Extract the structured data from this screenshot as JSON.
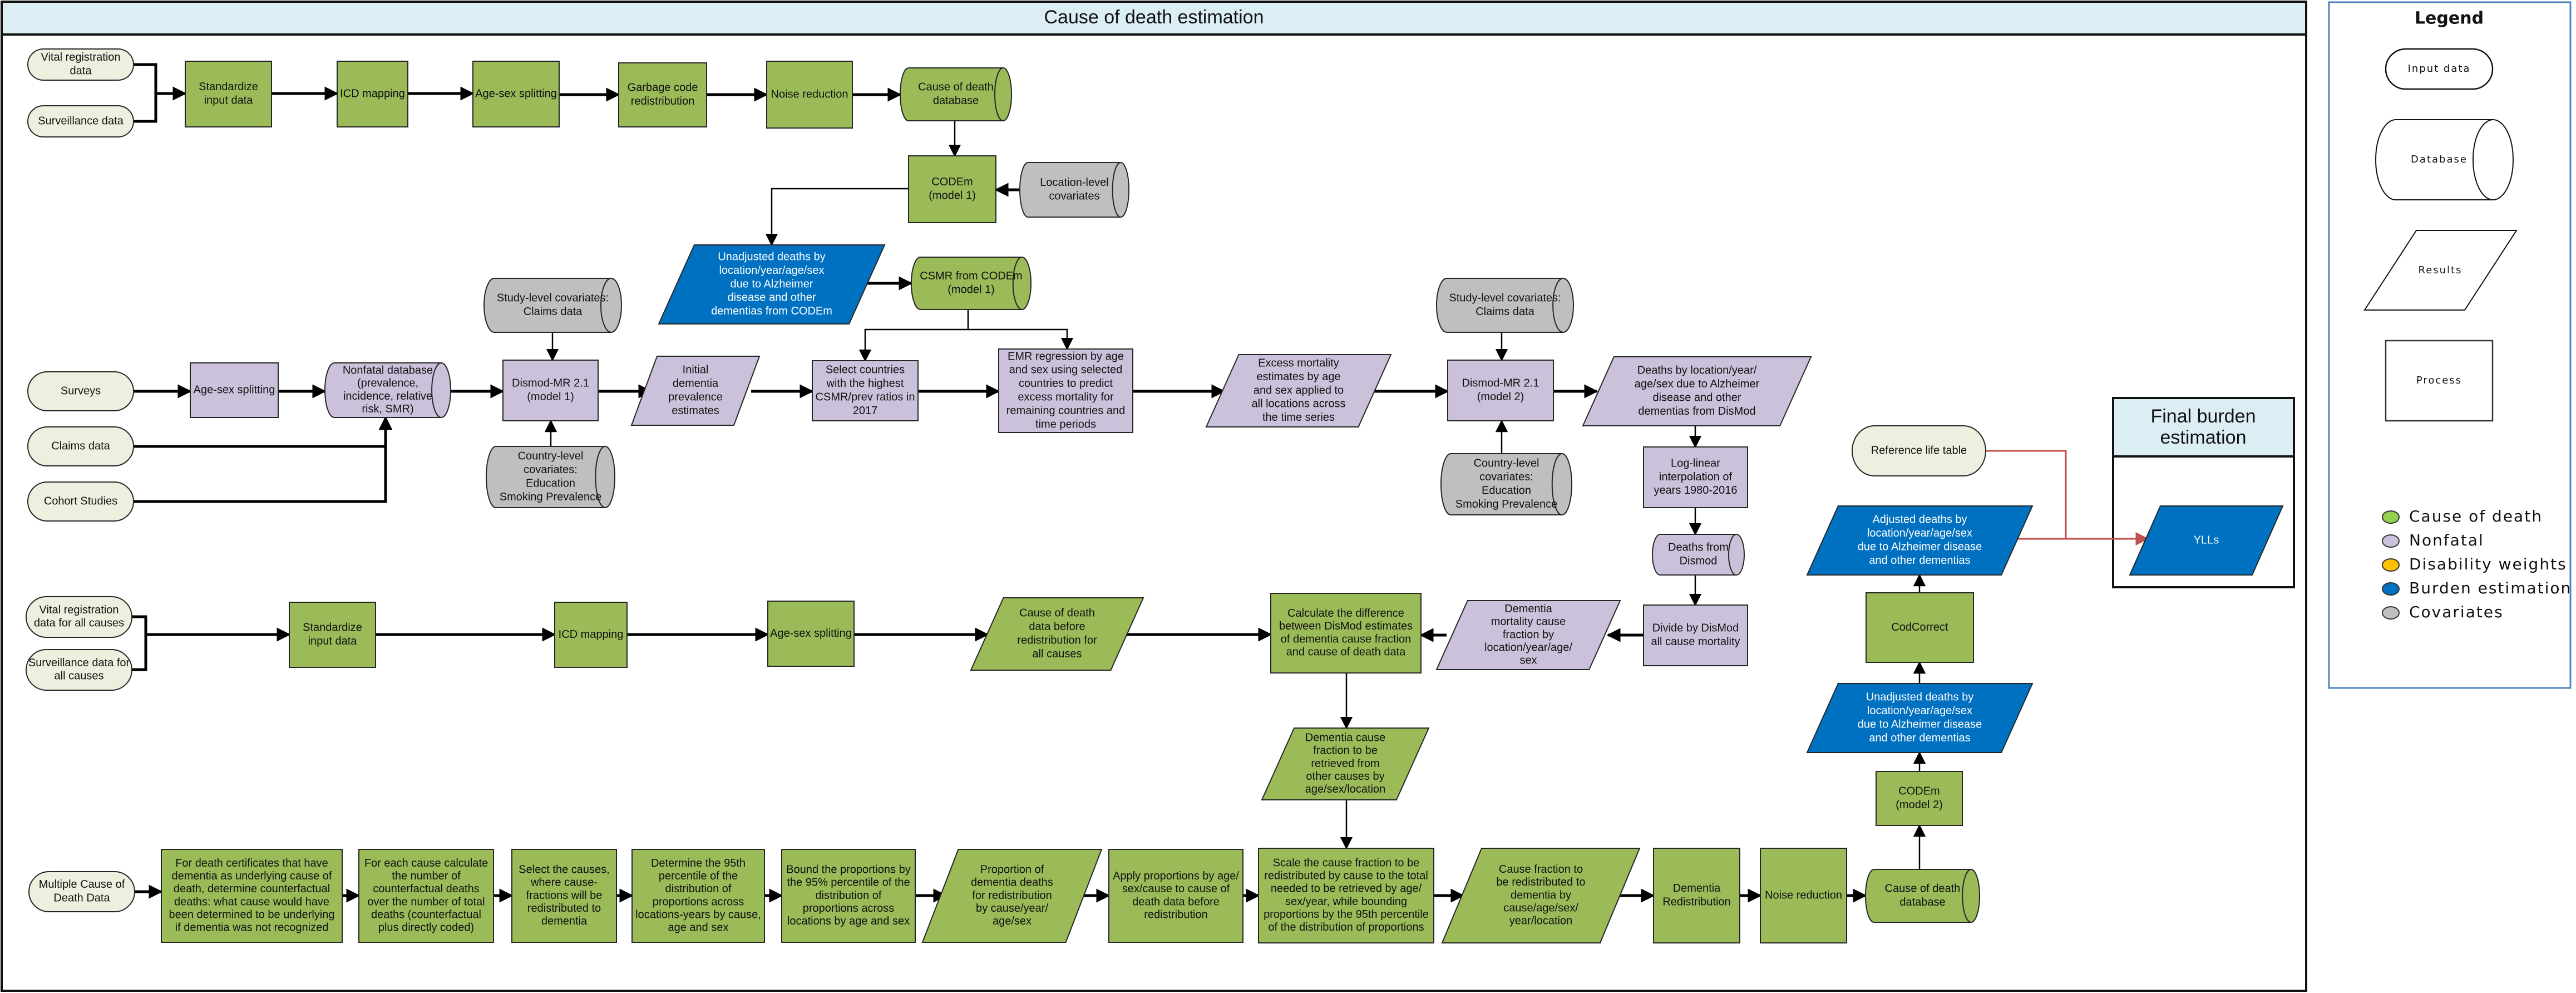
{
  "title": "Cause of death estimation",
  "colors": {
    "cause_of_death": "#9bbb59",
    "nonfatal": "#ccc1da",
    "disability_weights": "#ffc000",
    "burden_estimation": "#0070c0",
    "covariates": "#bfbfbf",
    "input": "#ebf1de",
    "header": "#dbeef4",
    "red_edge": "#c0504d"
  },
  "nodes": {
    "vr_data": [
      "Vital registration",
      "data"
    ],
    "surv_data": [
      "Surveillance data"
    ],
    "std_input_1": [
      "Standardize",
      "input data"
    ],
    "icd_map_1": [
      "ICD mapping"
    ],
    "agesex_1": [
      "Age-sex splitting"
    ],
    "garbage": [
      "Garbage code",
      "redistribution"
    ],
    "noise_1": [
      "Noise reduction"
    ],
    "cod_db_1": [
      "Cause of death",
      "database"
    ],
    "codem_1": [
      "CODEm",
      "(model 1)"
    ],
    "loc_cov": [
      "Location-level",
      "covariates"
    ],
    "unadj_codem": [
      "Unadjusted deaths by",
      "location/year/age/sex",
      "due to Alzheimer",
      "disease and other",
      "dementias from CODEm"
    ],
    "csmr": [
      "CSMR from CODEm",
      "(model 1)"
    ],
    "study_cov_1": [
      "Study-level covariates:",
      "Claims data"
    ],
    "country_cov_1": [
      "Country-level",
      "covariates:",
      "Education",
      "Smoking Prevalence"
    ],
    "surveys": [
      "Surveys"
    ],
    "claims": [
      "Claims data"
    ],
    "cohort": [
      "Cohort Studies"
    ],
    "agesex_nf": [
      "Age-sex splitting"
    ],
    "nonfatal_db": [
      "Nonfatal database",
      "(prevalence,",
      "incidence, relative",
      "risk, SMR)"
    ],
    "dismod_1": [
      "Dismod-MR 2.1",
      "(model 1)"
    ],
    "initial_prev": [
      "Initial",
      "dementia",
      "prevalence",
      "estimates"
    ],
    "select_countries": [
      "Select countries",
      "with the highest",
      "CSMR/prev ratios in",
      "2017"
    ],
    "emr_reg": [
      "EMR regression by age",
      "and sex using selected",
      "countries to predict",
      "excess mortality for",
      "remaining countries and",
      "time periods"
    ],
    "excess_mort": [
      "Excess mortality",
      "estimates by age",
      "and sex applied to",
      "all locations across",
      "the time series"
    ],
    "study_cov_2": [
      "Study-level covariates:",
      "Claims data"
    ],
    "country_cov_2": [
      "Country-level",
      "covariates:",
      "Education",
      "Smoking Prevalence"
    ],
    "dismod_2": [
      "Dismod-MR 2.1",
      "(model 2)"
    ],
    "deaths_dismod": [
      "Deaths by location/year/",
      "age/sex due to Alzheimer",
      "disease and other",
      "dementias from DisMod"
    ],
    "loglinear": [
      "Log-linear",
      "interpolation of",
      "years 1980-2016"
    ],
    "deaths_from_dismod": [
      "Deaths from",
      "Dismod"
    ],
    "divide_dismod": [
      "Divide by DisMod",
      "all cause mortality"
    ],
    "dementia_mcf": [
      "Dementia",
      "mortality cause",
      "fraction by",
      "location/year/age/",
      "sex"
    ],
    "ref_life": [
      "Reference life table"
    ],
    "adj_deaths": [
      "Adjusted deaths by",
      "location/year/age/sex",
      "due to Alzheimer disease",
      "and other dementias"
    ],
    "codcorrect": [
      "CodCorrect"
    ],
    "unadj_2": [
      "Unadjusted deaths by",
      "location/year/age/sex",
      "due to Alzheimer disease",
      "and other dementias"
    ],
    "codem_2": [
      "CODEm",
      "(model 2)"
    ],
    "vr_all": [
      "Vital registration",
      "data for all causes"
    ],
    "surv_all": [
      "Surveillance data for",
      "all causes"
    ],
    "std_input_2": [
      "Standardize",
      "input data"
    ],
    "icd_map_2": [
      "ICD mapping"
    ],
    "agesex_2": [
      "Age-sex splitting"
    ],
    "cod_before": [
      "Cause of death",
      "data before",
      "redistribution for",
      "all causes"
    ],
    "calc_diff": [
      "Calculate the difference",
      "between DisMod estimates",
      "of dementia cause fraction",
      "and cause of death data"
    ],
    "dem_cf_retrieve": [
      "Dementia cause",
      "fraction to be",
      "retrieved from",
      "other causes by",
      "age/sex/location"
    ],
    "mcod": [
      "Multiple Cause of",
      "Death Data"
    ],
    "counterfactual": [
      "For death certificates that have",
      "dementia as underlying cause of",
      "death, determine counterfactual",
      "deaths: what cause would have",
      "been determined to be underlying",
      "if dementia was not recognized"
    ],
    "each_cause": [
      "For each cause calculate",
      "the number of",
      "counterfactual deaths",
      "over the number of total",
      "deaths (counterfactual",
      "plus directly coded)"
    ],
    "select_causes": [
      "Select the causes,",
      "where cause-",
      "fractions will be",
      "redistributed to",
      "dementia"
    ],
    "det_95": [
      "Determine the 95th",
      "percentile of the",
      "distribution of",
      "proportions across",
      "locations-years by cause,",
      "age and sex"
    ],
    "bound_props": [
      "Bound the proportions by",
      "the 95% percentile of the",
      "distribution of",
      "proportions across",
      "locations by age and sex"
    ],
    "prop_dem": [
      "Proportion of",
      "dementia deaths",
      "for redistribution",
      "by cause/year/",
      "age/sex"
    ],
    "apply_props": [
      "Apply proportions by age/",
      "sex/cause to cause of",
      "death data before",
      "redistribution"
    ],
    "scale_cf": [
      "Scale the cause fraction to be",
      "redistributed by cause to the total",
      "needed to be retrieved by age/",
      "sex/year, while bounding",
      "proportions by the 95th percentile",
      "of the distribution of proportions"
    ],
    "cf_redist": [
      "Cause fraction to",
      "be redistributed to",
      "dementia by",
      "cause/age/sex/",
      "year/location"
    ],
    "dem_redist": [
      "Dementia",
      "Redistribution"
    ],
    "noise_2": [
      "Noise reduction"
    ],
    "cod_db_2": [
      "Cause of death",
      "database"
    ],
    "ylls": [
      "YLLs"
    ]
  },
  "final_burden": {
    "title_lines": [
      "Final burden",
      "estimation"
    ]
  },
  "legend": {
    "title": "Legend",
    "shapes": [
      {
        "shape": "terminator",
        "label": "Input data"
      },
      {
        "shape": "database",
        "label": "Database"
      },
      {
        "shape": "parallelogram",
        "label": "Results"
      },
      {
        "shape": "rectangle",
        "label": "Process"
      }
    ],
    "colors": [
      {
        "label": "Cause of death",
        "color": "#92d050"
      },
      {
        "label": "Nonfatal",
        "color": "#ccc1da"
      },
      {
        "label": "Disability weights",
        "color": "#ffc000"
      },
      {
        "label": "Burden estimation",
        "color": "#0070c0"
      },
      {
        "label": "Covariates",
        "color": "#bfbfbf"
      }
    ]
  }
}
